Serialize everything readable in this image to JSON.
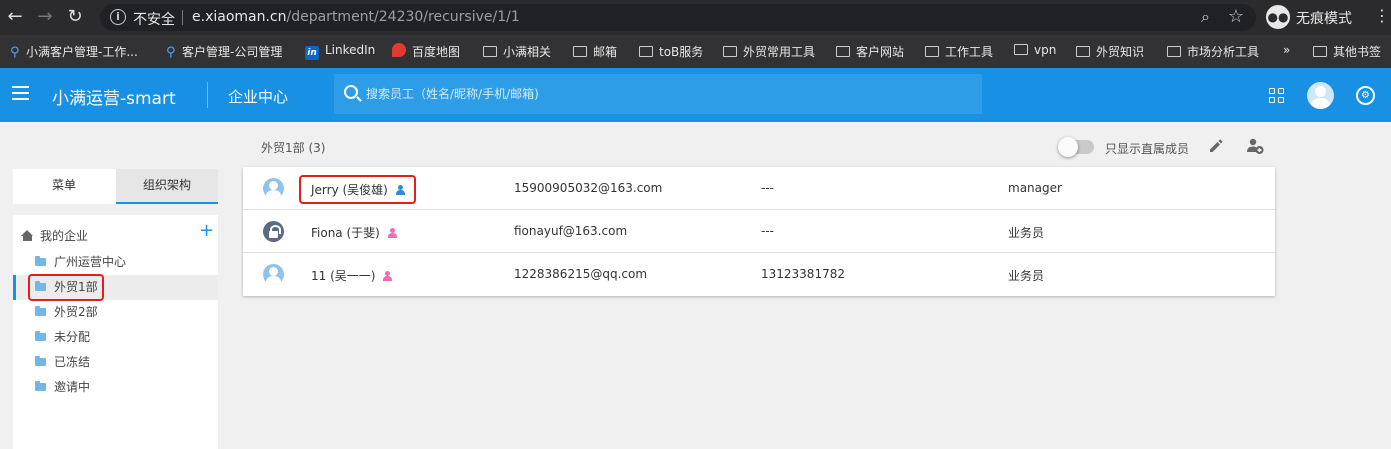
{
  "browser": {
    "insecure_label": "不安全",
    "url_host": "e.xiaoman.cn",
    "url_path": "/department/24230/recursive/1/1",
    "incognito_label": "无痕模式",
    "bookmarks": [
      "小满客户管理-工作...",
      "客户管理-公司管理",
      "LinkedIn",
      "百度地图",
      "小满相关",
      "邮箱",
      "toB服务",
      "外贸常用工具",
      "客户网站",
      "工作工具",
      "vpn",
      "外贸知识",
      "市场分析工具",
      "»",
      "其他书签"
    ]
  },
  "header": {
    "app_title": "小满运营-smart",
    "section": "企业中心",
    "search_placeholder": "搜索员工（姓名/昵称/手机/邮箱)"
  },
  "content": {
    "dept_heading": "外贸1部 (3)",
    "toggle_label": "只显示直属成员"
  },
  "sidebar": {
    "tabs": [
      "菜单",
      "组织架构"
    ],
    "root_label": "我的企业",
    "items": [
      "广州运营中心",
      "外贸1部",
      "外贸2部",
      "未分配",
      "已冻结",
      "邀请中"
    ],
    "selected_item": "外贸1部"
  },
  "members": [
    {
      "name": "Jerry (吴俊雄)",
      "gender": "male",
      "email": "15900905032@163.com",
      "phone": "---",
      "role": "manager",
      "avatar": "default"
    },
    {
      "name": "Fiona (于斐)",
      "gender": "female",
      "email": "fionayuf@163.com",
      "phone": "---",
      "role": "业务员",
      "avatar": "locked"
    },
    {
      "name": "11 (吴一一)",
      "gender": "female",
      "email": "1228386215@qq.com",
      "phone": "13123381782",
      "role": "业务员",
      "avatar": "default"
    }
  ],
  "colors": {
    "primary": "#1890e3",
    "highlight": "#e0201a",
    "male": "#2f8ad8",
    "female": "#f06ab8"
  }
}
